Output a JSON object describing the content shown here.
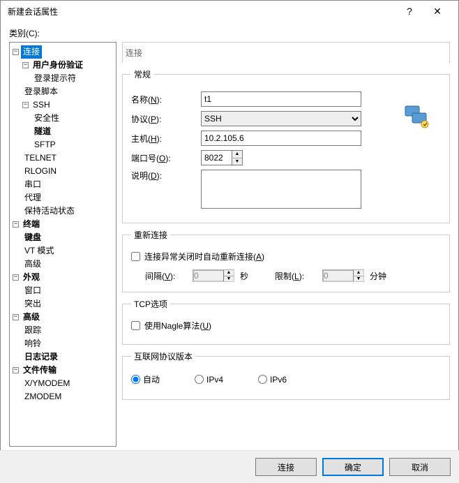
{
  "window": {
    "title": "新建会话属性",
    "help": "?",
    "close": "✕"
  },
  "category_label": "类别(C):",
  "tree": {
    "connection": "连接",
    "auth": "用户身份验证",
    "login_prompt": "登录提示符",
    "login_script": "登录脚本",
    "ssh": "SSH",
    "security": "安全性",
    "tunnel": "隧道",
    "sftp": "SFTP",
    "telnet": "TELNET",
    "rlogin": "RLOGIN",
    "serial": "串口",
    "proxy": "代理",
    "keepalive": "保持活动状态",
    "terminal": "终端",
    "keyboard": "键盘",
    "vtmode": "VT 模式",
    "advanced_term": "高级",
    "appearance": "外观",
    "window": "窗口",
    "highlight": "突出",
    "advanced": "高级",
    "trace": "跟踪",
    "bell": "响铃",
    "log": "日志记录",
    "filetransfer": "文件传输",
    "xymodem": "X/YMODEM",
    "zmodem": "ZMODEM"
  },
  "panel": {
    "header": "连接",
    "general": {
      "legend": "常规",
      "name_label_pre": "名称(",
      "name_label_u": "N",
      "name_label_post": "):",
      "name_value": "t1",
      "protocol_label_pre": "协议(",
      "protocol_label_u": "P",
      "protocol_label_post": "):",
      "protocol_value": "SSH",
      "host_label_pre": "主机(",
      "host_label_u": "H",
      "host_label_post": "):",
      "host_value": "10.2.105.6",
      "port_label_pre": "端口号(",
      "port_label_u": "O",
      "port_label_post": "):",
      "port_value": "8022",
      "desc_label_pre": "说明(",
      "desc_label_u": "D",
      "desc_label_post": "):",
      "desc_value": ""
    },
    "reconnect": {
      "legend": "重新连接",
      "checkbox_pre": "连接异常关闭时自动重新连接(",
      "checkbox_u": "A",
      "checkbox_post": ")",
      "interval_label_pre": "间隔(",
      "interval_label_u": "V",
      "interval_label_post": "):",
      "interval_value": "0",
      "interval_unit": "秒",
      "limit_label_pre": "限制(",
      "limit_label_u": "L",
      "limit_label_post": "):",
      "limit_value": "0",
      "limit_unit": "分钟"
    },
    "tcp": {
      "legend": "TCP选项",
      "nagle_pre": "使用Nagle算法(",
      "nagle_u": "U",
      "nagle_post": ")"
    },
    "ipver": {
      "legend": "互联网协议版本",
      "auto": "自动",
      "ipv4": "IPv4",
      "ipv6": "IPv6"
    }
  },
  "buttons": {
    "connect": "连接",
    "ok": "确定",
    "cancel": "取消"
  }
}
